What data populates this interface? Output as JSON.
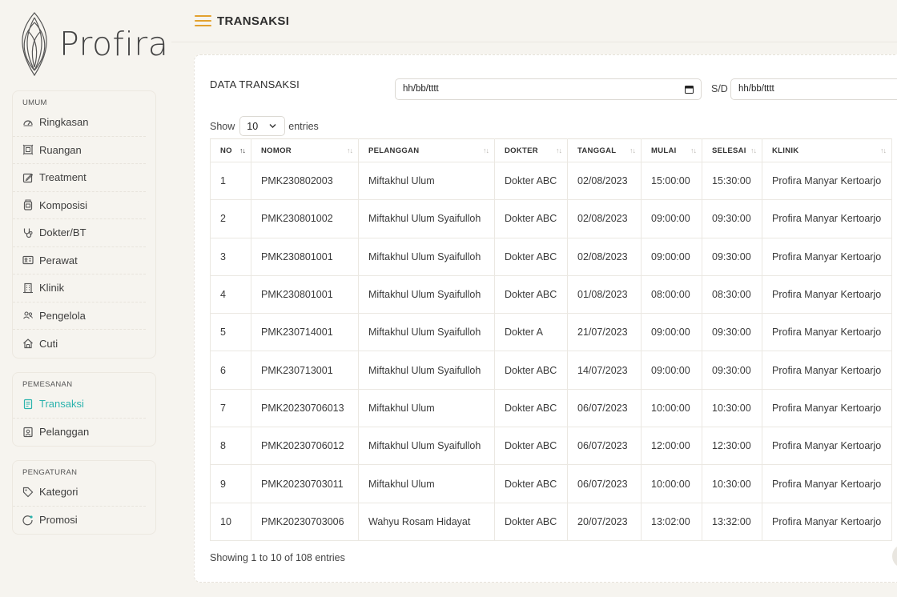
{
  "brand": {
    "name": "Profira"
  },
  "sidebar": {
    "groups": [
      {
        "title": "UMUM",
        "items": [
          {
            "label": "Ringkasan",
            "icon": "gauge-icon"
          },
          {
            "label": "Ruangan",
            "icon": "room-icon"
          },
          {
            "label": "Treatment",
            "icon": "edit-icon"
          },
          {
            "label": "Komposisi",
            "icon": "jar-icon"
          },
          {
            "label": "Dokter/BT",
            "icon": "stethoscope-icon"
          },
          {
            "label": "Perawat",
            "icon": "id-card-icon"
          },
          {
            "label": "Klinik",
            "icon": "building-icon"
          },
          {
            "label": "Pengelola",
            "icon": "users-icon"
          },
          {
            "label": "Cuti",
            "icon": "home-icon"
          }
        ]
      },
      {
        "title": "PEMESANAN",
        "items": [
          {
            "label": "Transaksi",
            "icon": "receipt-icon",
            "active": true
          },
          {
            "label": "Pelanggan",
            "icon": "contact-icon"
          }
        ]
      },
      {
        "title": "PENGATURAN",
        "items": [
          {
            "label": "Kategori",
            "icon": "tag-icon"
          },
          {
            "label": "Promosi",
            "icon": "promo-icon"
          }
        ]
      }
    ]
  },
  "header": {
    "title": "TRANSAKSI"
  },
  "card": {
    "title": "DATA TRANSAKSI",
    "date_from": "hh/bb/tttt",
    "sd_label": "S/D",
    "date_to": "hh/bb/tttt",
    "show_label": "Show",
    "page_size": "10",
    "entries_label": "entries",
    "info": "Showing 1 to 10 of 108 entries"
  },
  "table": {
    "columns": [
      "NO",
      "NOMOR",
      "PELANGGAN",
      "DOKTER",
      "TANGGAL",
      "MULAI",
      "SELESAI",
      "KLINIK"
    ],
    "rows": [
      [
        "1",
        "PMK230802003",
        "Miftakhul Ulum",
        "Dokter ABC",
        "02/08/2023",
        "15:00:00",
        "15:30:00",
        "Profira Manyar Kertoarjo"
      ],
      [
        "2",
        "PMK230801002",
        "Miftakhul Ulum Syaifulloh",
        "Dokter ABC",
        "02/08/2023",
        "09:00:00",
        "09:30:00",
        "Profira Manyar Kertoarjo"
      ],
      [
        "3",
        "PMK230801001",
        "Miftakhul Ulum Syaifulloh",
        "Dokter ABC",
        "02/08/2023",
        "09:00:00",
        "09:30:00",
        "Profira Manyar Kertoarjo"
      ],
      [
        "4",
        "PMK230801001",
        "Miftakhul Ulum Syaifulloh",
        "Dokter ABC",
        "01/08/2023",
        "08:00:00",
        "08:30:00",
        "Profira Manyar Kertoarjo"
      ],
      [
        "5",
        "PMK230714001",
        "Miftakhul Ulum Syaifulloh",
        "Dokter A",
        "21/07/2023",
        "09:00:00",
        "09:30:00",
        "Profira Manyar Kertoarjo"
      ],
      [
        "6",
        "PMK230713001",
        "Miftakhul Ulum Syaifulloh",
        "Dokter ABC",
        "14/07/2023",
        "09:00:00",
        "09:30:00",
        "Profira Manyar Kertoarjo"
      ],
      [
        "7",
        "PMK20230706013",
        "Miftakhul Ulum",
        "Dokter ABC",
        "06/07/2023",
        "10:00:00",
        "10:30:00",
        "Profira Manyar Kertoarjo"
      ],
      [
        "8",
        "PMK20230706012",
        "Miftakhul Ulum Syaifulloh",
        "Dokter ABC",
        "06/07/2023",
        "12:00:00",
        "12:30:00",
        "Profira Manyar Kertoarjo"
      ],
      [
        "9",
        "PMK20230703011",
        "Miftakhul Ulum",
        "Dokter ABC",
        "06/07/2023",
        "10:00:00",
        "10:30:00",
        "Profira Manyar Kertoarjo"
      ],
      [
        "10",
        "PMK20230703006",
        "Wahyu Rosam Hidayat",
        "Dokter ABC",
        "20/07/2023",
        "13:02:00",
        "13:32:00",
        "Profira Manyar Kertoarjo"
      ]
    ]
  },
  "colors": {
    "accent": "#2bb3ad",
    "hamburger": "#e2a12e",
    "background": "#f6f4ef"
  }
}
